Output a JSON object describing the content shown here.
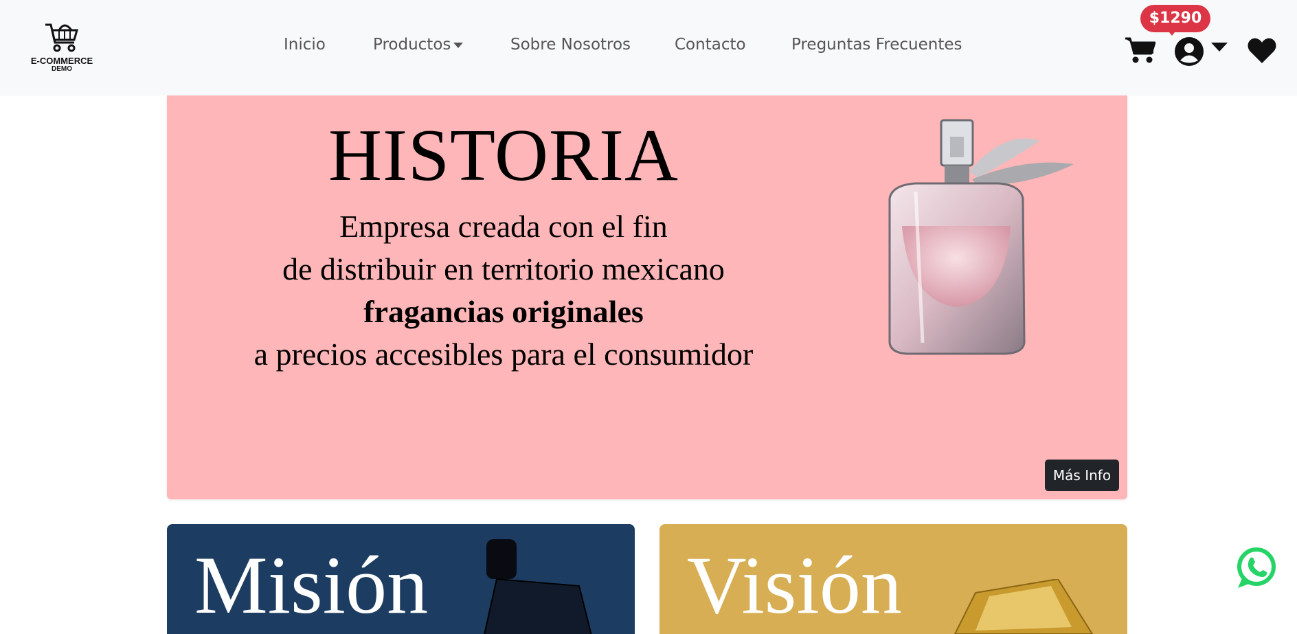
{
  "brand": {
    "line1": "E-COMMERCE",
    "line2": "DEMO"
  },
  "nav": {
    "inicio": "Inicio",
    "productos": "Productos",
    "sobre": "Sobre Nosotros",
    "contacto": "Contacto",
    "faq": "Preguntas Frecuentes"
  },
  "cart": {
    "total": "$1290"
  },
  "banner": {
    "title": "HISTORIA",
    "line1": "Empresa creada con el fin",
    "line2": "de distribuir en territorio mexicano",
    "line3": "fragancias originales",
    "line4": "a precios accesibles para el consumidor",
    "more_label": "Más Info",
    "background": "#feb6b8"
  },
  "cards": {
    "mision": {
      "title": "Misión",
      "background": "#1c3d61"
    },
    "vision": {
      "title": "Visión",
      "background": "#d7ae54"
    }
  },
  "colors": {
    "navbar": "#f8f9fa",
    "badge": "#dc3545",
    "whatsapp": "#25d366"
  },
  "icons": [
    "cart-icon",
    "user-icon",
    "heart-icon",
    "whatsapp-icon",
    "basket-logo-icon"
  ]
}
